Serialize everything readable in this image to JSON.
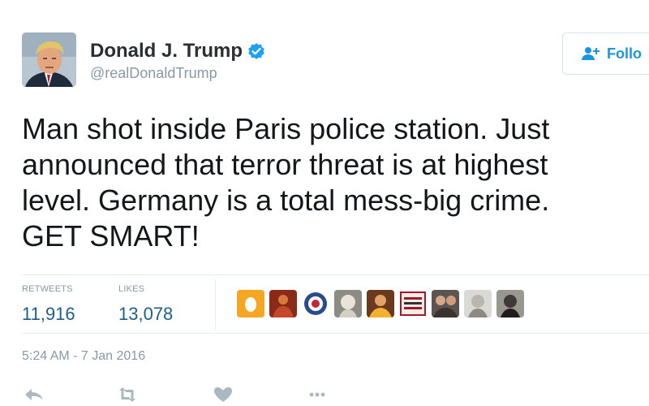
{
  "tweet": {
    "author": {
      "display_name": "Donald J. Trump",
      "screen_name": "@realDonaldTrump",
      "verified": true
    },
    "follow_label": "Follo",
    "text": "Man shot inside Paris police station. Just\nannounced that terror threat is at highest\nlevel. Germany is a total mess-big crime.\nGET SMART!",
    "stats": {
      "retweets_label": "RETWEETS",
      "retweets_value": "11,916",
      "likes_label": "LIKES",
      "likes_value": "13,078"
    },
    "liker_avatars": [
      "egg-avatar",
      "avatar-2",
      "avatar-3",
      "avatar-4",
      "avatar-5",
      "avatar-6",
      "avatar-7",
      "avatar-8",
      "avatar-9"
    ],
    "timestamp": "5:24 AM - 7 Jan 2016"
  },
  "colors": {
    "accent": "#1b95e0",
    "stat_value": "#1d5f8a",
    "muted": "#8899a6",
    "text": "#14171a",
    "divider": "#e6ecf0"
  },
  "icons": {
    "verified": "verified-badge-icon",
    "follow": "follow-person-plus-icon",
    "reply": "reply-icon",
    "retweet": "retweet-icon",
    "like": "heart-icon",
    "more": "more-dots-icon"
  }
}
